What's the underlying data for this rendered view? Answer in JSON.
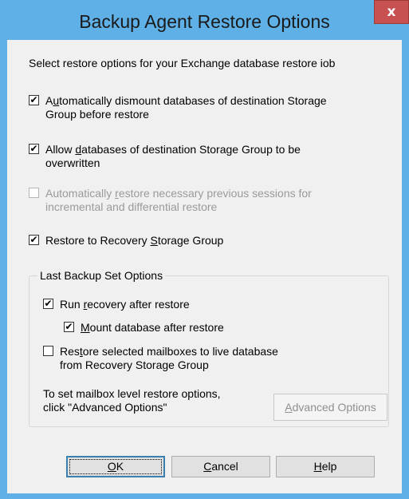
{
  "window": {
    "title": "Backup Agent Restore Options",
    "close_glyph": "x"
  },
  "intro_text": "Select  restore options for your Exchange database restore iob",
  "options": [
    {
      "prefix": "A",
      "ul": "u",
      "suffix": "tomatically dismount databases of destination Storage",
      "line2": "Group before restore",
      "checked": true,
      "enabled": true
    },
    {
      "prefix": "Allow ",
      "ul": "d",
      "suffix": "atabases of destination Storage Group to be",
      "line2": "overwritten",
      "checked": true,
      "enabled": true
    },
    {
      "prefix": "Automatically ",
      "ul": "r",
      "suffix": "estore necessary  previous sessions for",
      "line2": "incremental and  differential  restore",
      "checked": false,
      "enabled": false
    },
    {
      "prefix": "Restore to Recovery ",
      "ul": "S",
      "suffix": "torage Group",
      "checked": true,
      "enabled": true
    }
  ],
  "last_backup": {
    "legend": "Last Backup Set Options",
    "run_recovery": {
      "prefix": "Run ",
      "ul": "r",
      "suffix": "ecovery after restore",
      "checked": true
    },
    "mount_db": {
      "prefix": "",
      "ul": "M",
      "suffix": "ount database after restore",
      "checked": true
    },
    "restore_mailboxes": {
      "prefix": "Res",
      "ul": "t",
      "suffix": "ore selected mailboxes to live database",
      "line2": "from Recovery Storage Group",
      "checked": false
    },
    "note": "To set mailbox level restore options, click \"Advanced Options\"",
    "advanced": {
      "prefix": "",
      "ul": "A",
      "suffix": "dvanced Options"
    }
  },
  "buttons": {
    "ok": {
      "prefix": "",
      "ul": "O",
      "suffix": "K"
    },
    "cancel": {
      "prefix": "",
      "ul": "C",
      "suffix": "ancel"
    },
    "help": {
      "prefix": "",
      "ul": "H",
      "suffix": "elp"
    }
  },
  "colors": {
    "frame": "#5fb0e6",
    "close": "#c75050",
    "dialog_bg": "#f0f0f0",
    "disabled_text": "#9a9a9a"
  }
}
